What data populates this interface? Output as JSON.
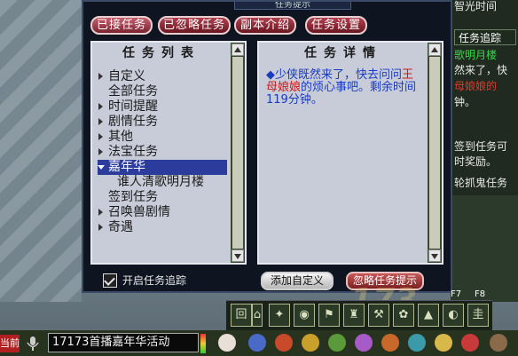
{
  "dialog": {
    "title": "任务提示",
    "tabs": [
      {
        "label": "已接任务",
        "active": true
      },
      {
        "label": "已忽略任务",
        "active": false
      },
      {
        "label": "副本介绍",
        "active": false
      },
      {
        "label": "任务设置",
        "active": false
      }
    ],
    "list_pane": {
      "header": "任务列表",
      "items": [
        {
          "label": "自定义",
          "expanded": false
        },
        {
          "label": "全部任务",
          "expanded": false
        },
        {
          "label": "时间提醒",
          "expanded": false
        },
        {
          "label": "剧情任务",
          "expanded": false
        },
        {
          "label": "其他",
          "expanded": false
        },
        {
          "label": "法宝任务",
          "expanded": false
        },
        {
          "label": "嘉年华",
          "expanded": true,
          "selected": true
        },
        {
          "label": "谁人清歌明月楼",
          "child": true
        },
        {
          "label": "签到任务",
          "expanded": false
        },
        {
          "label": "召唤兽剧情",
          "expanded": false
        },
        {
          "label": "奇遇",
          "expanded": false
        }
      ]
    },
    "detail_pane": {
      "header": "任务详情",
      "text_before": "◆少侠既然来了，快去问问",
      "highlight": "王母娘娘",
      "text_after": "的烦心事吧。剩余时间119分钟。"
    },
    "track_checkbox": {
      "label": "开启任务追踪",
      "checked": true
    },
    "add_custom_button": "添加自定义",
    "ignore_button": "忽略任务提示"
  },
  "side_panel": {
    "top_text": "智光时间",
    "tab": "任务追踪",
    "lines": [
      "歌明月楼",
      "然来了，快",
      "母娘娘的",
      "钟。",
      "签到任务可",
      "时奖励。",
      "轮抓鬼任务"
    ]
  },
  "hotbar": {
    "slots": [
      "回",
      "⌂",
      "✦",
      "◉",
      "⚑",
      "♜",
      "⚒",
      "✿",
      "▲",
      "◐",
      "▣",
      "圭"
    ],
    "fkeys": [
      "F7",
      "F8"
    ]
  },
  "chat": {
    "channel_label": "当前",
    "text": "17173首播嘉年华活动"
  },
  "colors": {
    "tab_bg": "#8a2a36",
    "selection": "#2c3c9c",
    "detail_text": "#1a3bbf",
    "highlight_text": "#d01818"
  }
}
